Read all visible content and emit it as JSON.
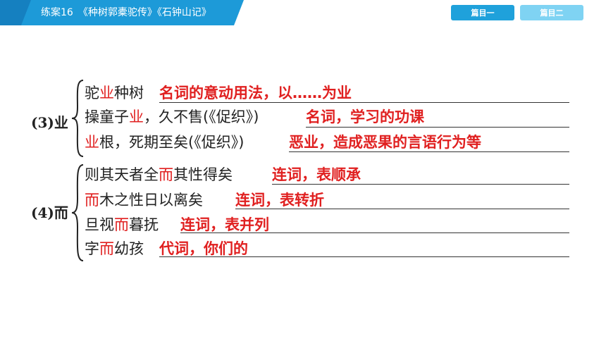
{
  "header": {
    "title": "练案16　《种树郭橐驼传》《石钟山记》",
    "tabs": [
      {
        "label": "篇目一",
        "active": true
      },
      {
        "label": "篇目二",
        "active": false
      }
    ],
    "colors": {
      "ribbon": "#1d9ad8",
      "tab_active": "#1fa1db",
      "tab_inactive": "#7fd3f3"
    }
  },
  "groups": [
    {
      "label": "(3)业",
      "items": [
        {
          "pre": "驼",
          "hl": "业",
          "post": "种树",
          "answer": "名词的意动用法，以……为业"
        },
        {
          "pre": "操童子",
          "hl": "业",
          "post": "，久不售(《促织》)",
          "answer": "名词，学习的功课"
        },
        {
          "pre": "",
          "hl": "业",
          "post": "根，死期至矣(《促织》)",
          "answer": "恶业，造成恶果的言语行为等"
        }
      ]
    },
    {
      "label": "(4)而",
      "items": [
        {
          "pre": "则其天者全",
          "hl": "而",
          "post": "其性得矣",
          "answer": "连词，表顺承"
        },
        {
          "pre": "",
          "hl": "而",
          "post": "木之性日以离矣",
          "answer": "连词，表转折"
        },
        {
          "pre": "旦视",
          "hl": "而",
          "post": "暮抚",
          "answer": "连词，表并列"
        },
        {
          "pre": "字",
          "hl": "而",
          "post": "幼孩",
          "answer": "代词，你们的"
        }
      ]
    }
  ]
}
